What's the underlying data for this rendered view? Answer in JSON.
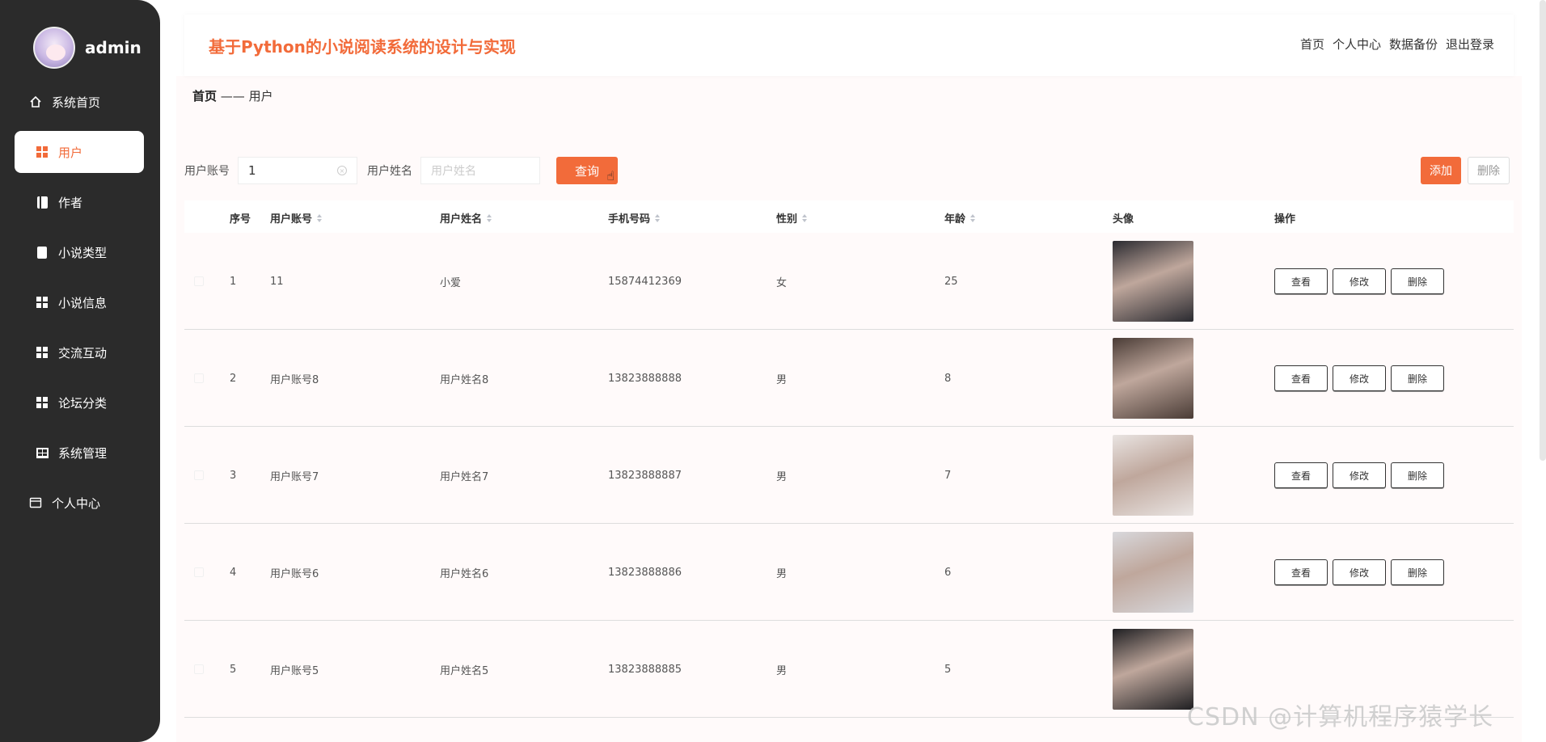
{
  "sidebar": {
    "user_name": "admin",
    "items": [
      {
        "label": "系统首页",
        "icon": "home-icon"
      },
      {
        "label": "用户",
        "icon": "grid-icon",
        "active": true
      },
      {
        "label": "作者",
        "icon": "book-icon"
      },
      {
        "label": "小说类型",
        "icon": "clipboard-icon"
      },
      {
        "label": "小说信息",
        "icon": "grid-icon"
      },
      {
        "label": "交流互动",
        "icon": "grid-icon"
      },
      {
        "label": "论坛分类",
        "icon": "grid-icon"
      },
      {
        "label": "系统管理",
        "icon": "table-icon"
      },
      {
        "label": "个人中心",
        "icon": "card-icon"
      }
    ]
  },
  "header": {
    "title": "基于Python的小说阅读系统的设计与实现",
    "links": [
      "首页",
      "个人中心",
      "数据备份",
      "退出登录"
    ]
  },
  "breadcrumb": {
    "home": "首页",
    "sep": " —— ",
    "current": "用户"
  },
  "search": {
    "account_label": "用户账号",
    "account_value": "1",
    "name_label": "用户姓名",
    "name_placeholder": "用户姓名",
    "query_label": "查询"
  },
  "actions": {
    "add_label": "添加",
    "delete_label": "删除"
  },
  "table": {
    "headers": [
      "序号",
      "用户账号",
      "用户姓名",
      "手机号码",
      "性别",
      "年龄",
      "头像",
      "操作"
    ],
    "op_labels": [
      "查看",
      "修改",
      "删除"
    ],
    "rows": [
      {
        "no": "1",
        "account": "11",
        "name": "小爱",
        "phone": "15874412369",
        "gender": "女",
        "age": "25",
        "photo_color": "#2a2a30",
        "has_ops": true
      },
      {
        "no": "2",
        "account": "用户账号8",
        "name": "用户姓名8",
        "phone": "13823888888",
        "gender": "男",
        "age": "8",
        "photo_color": "#4a3c36",
        "has_ops": true
      },
      {
        "no": "3",
        "account": "用户账号7",
        "name": "用户姓名7",
        "phone": "13823888887",
        "gender": "男",
        "age": "7",
        "photo_color": "#e9e4e2",
        "has_ops": true
      },
      {
        "no": "4",
        "account": "用户账号6",
        "name": "用户姓名6",
        "phone": "13823888886",
        "gender": "男",
        "age": "6",
        "photo_color": "#d8d8dc",
        "has_ops": true
      },
      {
        "no": "5",
        "account": "用户账号5",
        "name": "用户姓名5",
        "phone": "13823888885",
        "gender": "男",
        "age": "5",
        "photo_color": "#1f1f22",
        "has_ops": false
      }
    ]
  },
  "watermark": "CSDN @计算机程序猿学长"
}
